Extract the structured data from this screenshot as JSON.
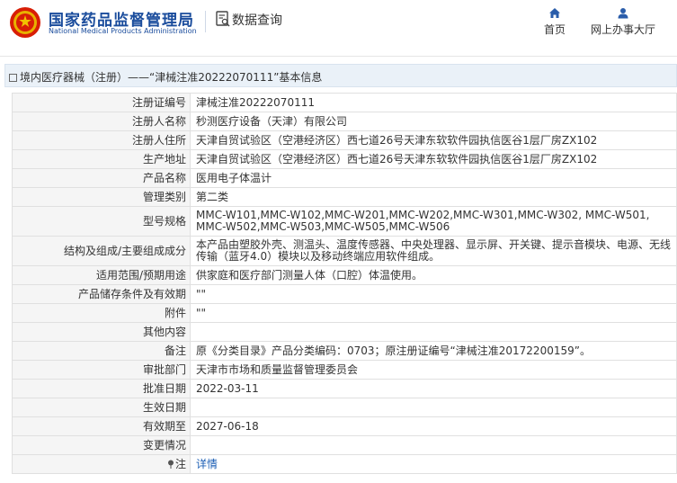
{
  "header": {
    "brand_cn": "国家药品监督管理局",
    "brand_en": "National Medical Products Administration",
    "data_query": "数据查询",
    "nav": {
      "home": "首页",
      "office": "网上办事大厅"
    }
  },
  "breadcrumb": "境内医疗器械（注册）——“津械注准20222070111”基本信息",
  "rows": [
    {
      "label": "注册证编号",
      "value": "津械注准20222070111"
    },
    {
      "label": "注册人名称",
      "value": "秒测医疗设备（天津）有限公司"
    },
    {
      "label": "注册人住所",
      "value": "天津自贸试验区（空港经济区）西七道26号天津东软软件园执信医谷1层厂房ZX102"
    },
    {
      "label": "生产地址",
      "value": "天津自贸试验区（空港经济区）西七道26号天津东软软件园执信医谷1层厂房ZX102"
    },
    {
      "label": "产品名称",
      "value": "医用电子体温计"
    },
    {
      "label": "管理类别",
      "value": "第二类"
    },
    {
      "label": "型号规格",
      "value": "MMC-W101,MMC-W102,MMC-W201,MMC-W202,MMC-W301,MMC-W302, MMC-W501, MMC-W502,MMC-W503,MMC-W505,MMC-W506"
    },
    {
      "label": "结构及组成/主要组成成分",
      "value": "本产品由塑胶外壳、测温头、温度传感器、中央处理器、显示屏、开关键、提示音模块、电源、无线传输（蓝牙4.0）模块以及移动终端应用软件组成。"
    },
    {
      "label": "适用范围/预期用途",
      "value": "供家庭和医疗部门测量人体（口腔）体温使用。"
    },
    {
      "label": "产品储存条件及有效期",
      "value": "\"\""
    },
    {
      "label": "附件",
      "value": "\"\""
    },
    {
      "label": "其他内容",
      "value": ""
    },
    {
      "label": "备注",
      "value": "原《分类目录》产品分类编码：0703；原注册证编号“津械注准20172200159”。"
    },
    {
      "label": "审批部门",
      "value": "天津市市场和质量监督管理委员会"
    },
    {
      "label": "批准日期",
      "value": "2022-03-11"
    },
    {
      "label": "生效日期",
      "value": ""
    },
    {
      "label": "有效期至",
      "value": "2027-06-18"
    },
    {
      "label": "变更情况",
      "value": ""
    },
    {
      "label": "注",
      "value": "详情"
    }
  ],
  "colors": {
    "brand_blue": "#1a4c9c",
    "link_blue": "#1d5fb5",
    "label_bg": "#f5f5f5",
    "breadcrumb_bg": "#eaf1f8"
  },
  "icons": [
    "emblem-logo",
    "data-query-icon",
    "home-icon",
    "user-icon",
    "breadcrumb-icon",
    "pin-icon"
  ]
}
